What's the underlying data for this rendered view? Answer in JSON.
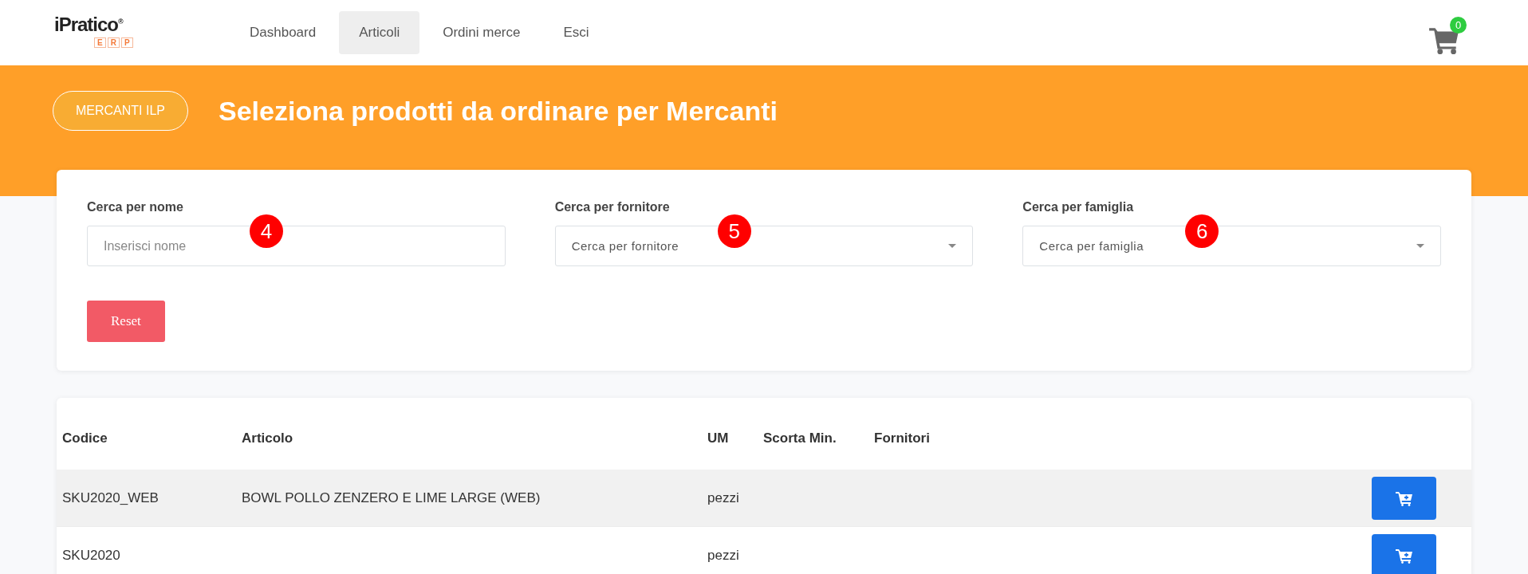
{
  "header": {
    "logo": {
      "name": "iPratico",
      "mark": "®",
      "sub": [
        "E",
        "R",
        "P"
      ]
    },
    "nav": [
      {
        "label": "Dashboard",
        "selected": false
      },
      {
        "label": "Articoli",
        "selected": true
      },
      {
        "label": "Ordini merce",
        "selected": false
      },
      {
        "label": "Esci",
        "selected": false
      }
    ],
    "cart": {
      "count": "0"
    }
  },
  "banner": {
    "store_button": "MERCANTI ILP",
    "title": "Seleziona prodotti da ordinare per Mercanti"
  },
  "filters": [
    {
      "kind": "text",
      "label": "Cerca per nome",
      "placeholder": "Inserisci nome",
      "marker": "4"
    },
    {
      "kind": "select",
      "label": "Cerca per fornitore",
      "placeholder": "Cerca per fornitore",
      "marker": "5"
    },
    {
      "kind": "select",
      "label": "Cerca per famiglia",
      "placeholder": "Cerca per famiglia",
      "marker": "6"
    }
  ],
  "reset_button": "Reset",
  "table": {
    "columns": [
      "Codice",
      "Articolo",
      "UM",
      "Scorta Min.",
      "Fornitori"
    ],
    "rows": [
      {
        "code": "SKU2020_WEB",
        "article": "BOWL POLLO ZENZERO E LIME LARGE (WEB)",
        "um": "pezzi",
        "highlighted": true
      },
      {
        "code": "SKU2020",
        "um": "pezzi",
        "highlighted": false
      }
    ]
  }
}
